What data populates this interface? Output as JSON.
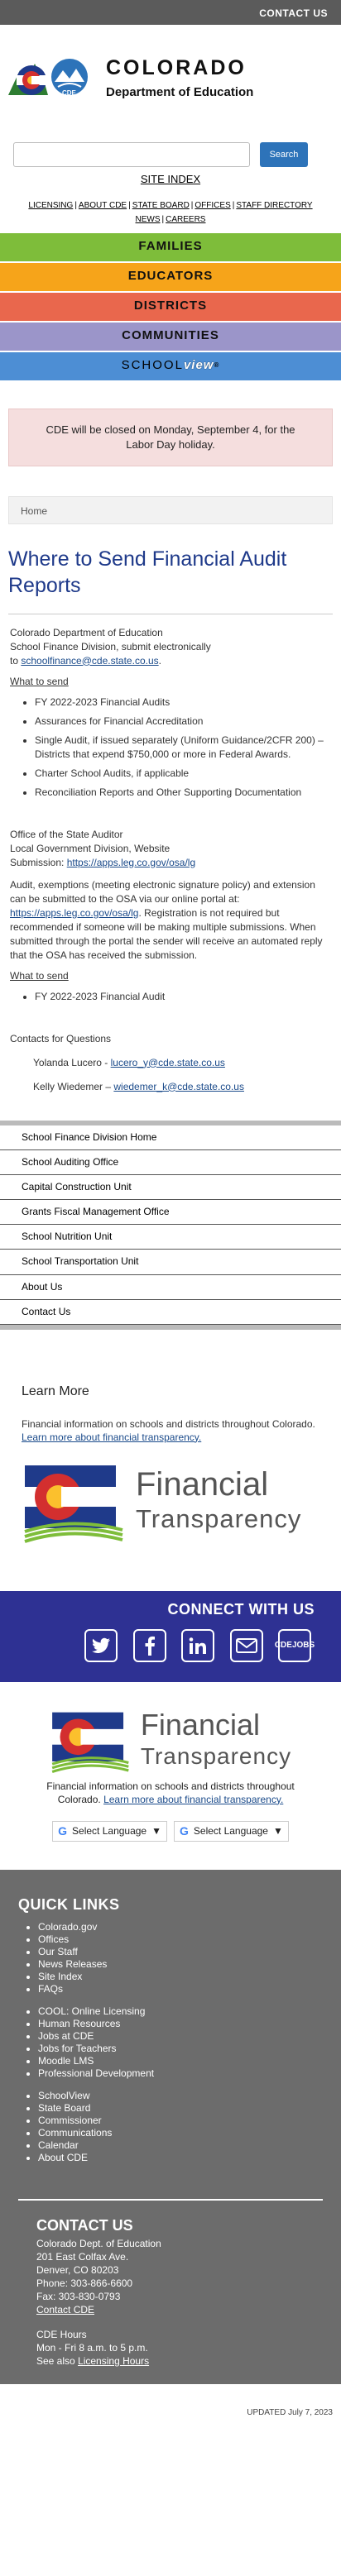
{
  "topbar": {
    "contact": "CONTACT US"
  },
  "logo": {
    "line1": "COLORADO",
    "line2": "Department of Education",
    "badge": "CDE"
  },
  "search": {
    "placeholder": "",
    "button": "Search"
  },
  "site_index": "SITE INDEX",
  "util_links": [
    "LICENSING",
    "ABOUT CDE",
    "STATE BOARD",
    "OFFICES",
    "STAFF DIRECTORY",
    "NEWS",
    "CAREERS"
  ],
  "audience": {
    "families": "FAMILIES",
    "educators": "EDUCATORS",
    "districts": "DISTRICTS",
    "communities": "COMMUNITIES",
    "schoolview_a": "SCHOOL",
    "schoolview_b": "view",
    "schoolview_tm": "®"
  },
  "alert": "CDE will be closed on Monday, September 4, for the Labor Day holiday.",
  "breadcrumb": "Home",
  "page_title": "Where to Send Financial Audit Reports",
  "section1": {
    "org": "Colorado Department of Education",
    "division": "School Finance Division, submit electronically",
    "to_prefix": "to ",
    "email": "schoolfinance@cde.state.co.us",
    "to_suffix": ".",
    "what_to_send": "What to send",
    "items": [
      "FY 2022-2023 Financial Audits",
      "Assurances for Financial Accreditation",
      "Single Audit, if issued separately (Uniform Guidance/2CFR 200) – Districts that expend $750,000 or more in Federal Awards.",
      "Charter School Audits, if applicable",
      "Reconciliation Reports and Other Supporting Documentation"
    ]
  },
  "section2": {
    "office": "Office of the State Auditor",
    "division": "Local Government Division, Website",
    "submission_label": "Submission: ",
    "submission_url": "https://apps.leg.co.gov/osa/lg",
    "body_a": "Audit, exemptions (meeting electronic signature policy) and extension can be submitted to the OSA via our online portal at: ",
    "body_url": "https://apps.leg.co.gov/osa/lg",
    "body_b": ". Registration is not required but recommended if someone will be making multiple submissions. When submitted through the portal the sender will receive an automated reply that the OSA has received the submission.",
    "what_to_send": "What to send",
    "items": [
      "FY 2022-2023 Financial Audit"
    ]
  },
  "contacts": {
    "title": "Contacts for Questions",
    "people": [
      {
        "name": "Yolanda Lucero -  ",
        "email": "lucero_y@cde.state.co.us"
      },
      {
        "name": "Kelly Wiedemer – ",
        "email": "wiedemer_k@cde.state.co.us"
      }
    ]
  },
  "side_nav": [
    "School Finance Division Home",
    "School Auditing Office",
    "Capital Construction Unit",
    "Grants Fiscal Management Office",
    "School Nutrition Unit",
    "School Transportation Unit",
    "About Us",
    "Contact Us"
  ],
  "learn_more": {
    "title": "Learn More",
    "text": "Financial information on schools and districts throughout Colorado. ",
    "link": "Learn more about financial transparency.",
    "logo_a": "Financial",
    "logo_b": "Transparency"
  },
  "connect": {
    "title": "CONNECT WITH US",
    "icons": [
      "twitter-icon",
      "facebook-icon",
      "linkedin-icon",
      "email-icon",
      "cde-jobs-icon"
    ],
    "jobs_a": "CDE",
    "jobs_b": "JOBS"
  },
  "translate": {
    "label": "Select Language",
    "label2": "Select Language"
  },
  "footer": {
    "quick_links": "QUICK LINKS",
    "group1": [
      "Colorado.gov",
      "Offices",
      "Our Staff",
      "News Releases",
      "Site Index",
      "FAQs"
    ],
    "group2": [
      "COOL: Online Licensing",
      "Human Resources",
      "Jobs at CDE",
      "Jobs for Teachers",
      "Moodle LMS",
      "Professional Development"
    ],
    "group3": [
      "SchoolView",
      "State Board",
      "Commissioner",
      "Communications",
      "Calendar",
      "About CDE"
    ],
    "contact_title": "CONTACT US",
    "address": [
      "Colorado Dept. of Education",
      "201 East Colfax Ave.",
      "Denver, CO 80203",
      "Phone: 303-866-6600",
      "Fax: 303-830-0793"
    ],
    "contact_cde": "Contact CDE",
    "hours_title": "CDE Hours",
    "hours": "Mon - Fri 8 a.m. to 5 p.m.",
    "see_also": "See also ",
    "licensing_hours": "Licensing Hours"
  },
  "updated": "UPDATED July 7, 2023"
}
